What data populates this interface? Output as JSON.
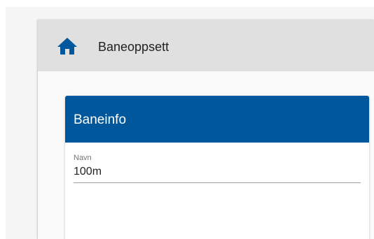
{
  "header": {
    "title": "Baneoppsett",
    "home_icon": "home-icon",
    "home_icon_color": "#01579b"
  },
  "card": {
    "title": "Baneinfo",
    "header_color": "#01579b",
    "fields": [
      {
        "label": "Navn",
        "value": "100m"
      }
    ]
  }
}
